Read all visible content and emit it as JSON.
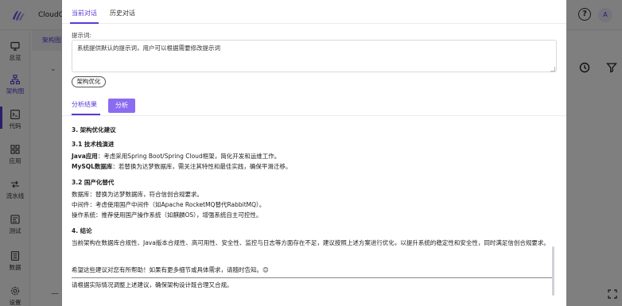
{
  "app": {
    "name": "CloudOS",
    "avatar_initial": "A"
  },
  "sidebar": {
    "items": [
      {
        "label": "总览",
        "icon": "monitor-icon"
      },
      {
        "label": "架构图",
        "icon": "hierarchy-icon",
        "active": true
      },
      {
        "label": "代码",
        "icon": "terminal-icon"
      },
      {
        "label": "应用",
        "icon": "grid-icon"
      },
      {
        "label": "流水线",
        "icon": "pipeline-icon"
      },
      {
        "label": "测试",
        "icon": "test-icon"
      },
      {
        "label": "数据",
        "icon": "database-icon"
      },
      {
        "label": "设置",
        "icon": "gear-icon"
      }
    ]
  },
  "background": {
    "subtab": "架构图",
    "collapse_symbol": "⌄",
    "minus": "—"
  },
  "modal": {
    "tabs": [
      {
        "label": "当前对话",
        "active": true
      },
      {
        "label": "历史对话"
      }
    ],
    "prompt_label": "提示词:",
    "prompt_value": "系统提供默认的提示词，用户可以根据需要修改提示词",
    "optimize_button": "架构优化",
    "result_tab": "分析结果",
    "analyze_button": "分析",
    "result": {
      "h1": "3. 架构优化建议",
      "h2": "3.1 技术栈演进",
      "java_label": "Java应用",
      "java_text": "：考虑采用Spring Boot/Spring Cloud框架，简化开发和运维工作。",
      "mysql_label": "MySQL数据库",
      "mysql_text": "：若替换为达梦数据库，需关注其特性和最佳实践，确保平滑迁移。",
      "h3": "3.2 国产化替代",
      "db_text": "数据库：替换为达梦数据库，符合信创合规要求。",
      "mw_text": "中间件：考虑使用国产中间件（如Apache RocketMQ替代RabbitMQ）。",
      "os_text": "操作系统：推荐使用国产操作系统（如麒麟OS），增强系统自主可控性。",
      "h4": "4. 结论",
      "conclusion": "当前架构在数据库合规性、Java版本合规性、高可用性、安全性、监控与日志等方面存在不足，建议按照上述方案进行优化，以提升系统的稳定性和安全性，同时满足信创合规要求。",
      "closing": "希望这些建议对您有所帮助！如果有更多细节或具体需求，请随时告知。😊",
      "footer": "请根据实际情况调整上述建议，确保架构设计既合理又合规。"
    }
  },
  "colors": {
    "accent": "#5b3ad6",
    "button": "#8b6cf0",
    "overlay": "rgba(0,0,0,0.5)"
  }
}
